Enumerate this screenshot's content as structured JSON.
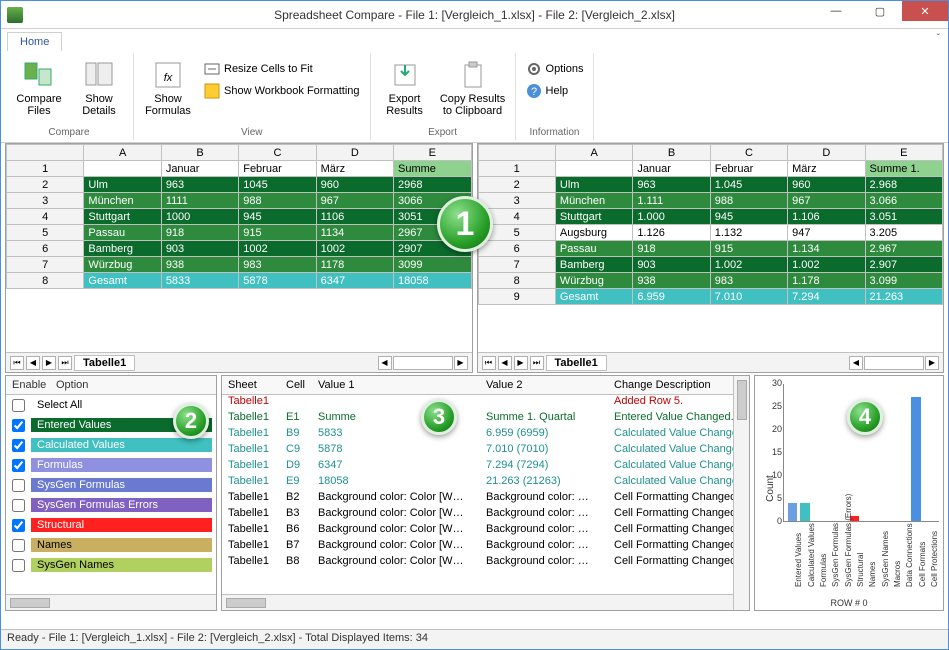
{
  "title": "Spreadsheet Compare - File 1: [Vergleich_1.xlsx] - File 2: [Vergleich_2.xlsx]",
  "tabs": {
    "home": "Home"
  },
  "ribbon": {
    "compare": {
      "label": "Compare",
      "compareFiles": "Compare\nFiles",
      "showDetails": "Show\nDetails"
    },
    "view": {
      "label": "View",
      "showFormulas": "Show\nFormulas",
      "resize": "Resize Cells to Fit",
      "formatting": "Show Workbook Formatting"
    },
    "export": {
      "label": "Export",
      "exportResults": "Export\nResults",
      "copyResults": "Copy Results\nto Clipboard"
    },
    "information": {
      "label": "Information",
      "options": "Options",
      "help": "Help"
    }
  },
  "sheetTab": "Tabelle1",
  "grid1": {
    "cols": [
      "A",
      "B",
      "C",
      "D",
      "E"
    ],
    "header": [
      "",
      "Januar",
      "Februar",
      "März",
      "Summe"
    ],
    "rows": [
      [
        "Ulm",
        "963",
        "1045",
        "960",
        "2968"
      ],
      [
        "München",
        "1111",
        "988",
        "967",
        "3066"
      ],
      [
        "Stuttgart",
        "1000",
        "945",
        "1106",
        "3051"
      ],
      [
        "Passau",
        "918",
        "915",
        "1134",
        "2967"
      ],
      [
        "Bamberg",
        "903",
        "1002",
        "1002",
        "2907"
      ],
      [
        "Würzbug",
        "938",
        "983",
        "1178",
        "3099"
      ],
      [
        "Gesamt",
        "5833",
        "5878",
        "6347",
        "18058"
      ]
    ]
  },
  "grid2": {
    "cols": [
      "A",
      "B",
      "C",
      "D",
      "E"
    ],
    "header": [
      "",
      "Januar",
      "Februar",
      "März",
      "Summe 1."
    ],
    "rows": [
      [
        "Ulm",
        "963",
        "1.045",
        "960",
        "2.968"
      ],
      [
        "München",
        "1.111",
        "988",
        "967",
        "3.066"
      ],
      [
        "Stuttgart",
        "1.000",
        "945",
        "1.106",
        "3.051"
      ],
      [
        "Augsburg",
        "1.126",
        "1.132",
        "947",
        "3.205"
      ],
      [
        "Passau",
        "918",
        "915",
        "1.134",
        "2.967"
      ],
      [
        "Bamberg",
        "903",
        "1.002",
        "1.002",
        "2.907"
      ],
      [
        "Würzbug",
        "938",
        "983",
        "1.178",
        "3.099"
      ],
      [
        "Gesamt",
        "6.959",
        "7.010",
        "7.294",
        "21.263"
      ]
    ]
  },
  "options": {
    "headerEnable": "Enable",
    "headerOption": "Option",
    "items": [
      {
        "checked": false,
        "label": "Select All",
        "cls": ""
      },
      {
        "checked": true,
        "label": "Entered Values",
        "cls": "ev"
      },
      {
        "checked": true,
        "label": "Calculated Values",
        "cls": "cv"
      },
      {
        "checked": true,
        "label": "Formulas",
        "cls": "fm"
      },
      {
        "checked": false,
        "label": "SysGen Formulas",
        "cls": "sf"
      },
      {
        "checked": false,
        "label": "SysGen Formulas Errors",
        "cls": "se"
      },
      {
        "checked": true,
        "label": "Structural",
        "cls": "st"
      },
      {
        "checked": false,
        "label": "Names",
        "cls": "nm"
      },
      {
        "checked": false,
        "label": "SysGen Names",
        "cls": "sn"
      }
    ]
  },
  "diff": {
    "headers": {
      "sheet": "Sheet",
      "cell": "Cell",
      "v1": "Value 1",
      "v2": "Value 2",
      "desc": "Change Description"
    },
    "rows": [
      {
        "sheet": "Tabelle1",
        "cell": "",
        "v1": "",
        "v2": "",
        "desc": "Added Row 5.",
        "color": "red"
      },
      {
        "sheet": "Tabelle1",
        "cell": "E1",
        "v1": "Summe",
        "v2": "Summe 1. Quartal",
        "desc": "Entered Value Changed.",
        "color": "green"
      },
      {
        "sheet": "Tabelle1",
        "cell": "B9",
        "v1": "5833",
        "v2": "6.959   (6959)",
        "desc": "Calculated Value Changed.",
        "color": "teal"
      },
      {
        "sheet": "Tabelle1",
        "cell": "C9",
        "v1": "5878",
        "v2": "7.010   (7010)",
        "desc": "Calculated Value Changed.",
        "color": "teal"
      },
      {
        "sheet": "Tabelle1",
        "cell": "D9",
        "v1": "6347",
        "v2": "7.294   (7294)",
        "desc": "Calculated Value Changed.",
        "color": "teal"
      },
      {
        "sheet": "Tabelle1",
        "cell": "E9",
        "v1": "18058",
        "v2": "21.263   (21263)",
        "desc": "Calculated Value Changed.",
        "color": "teal"
      },
      {
        "sheet": "Tabelle1",
        "cell": "B2",
        "v1": "Background color: Color [W…",
        "v2": "Background color: …",
        "desc": "Cell Formatting Changed",
        "color": "black"
      },
      {
        "sheet": "Tabelle1",
        "cell": "B3",
        "v1": "Background color: Color [W…",
        "v2": "Background color: …",
        "desc": "Cell Formatting Changed",
        "color": "black"
      },
      {
        "sheet": "Tabelle1",
        "cell": "B6",
        "v1": "Background color: Color [W…",
        "v2": "Background color: …",
        "desc": "Cell Formatting Changed",
        "color": "black"
      },
      {
        "sheet": "Tabelle1",
        "cell": "B7",
        "v1": "Background color: Color [W…",
        "v2": "Background color: …",
        "desc": "Cell Formatting Changed",
        "color": "black"
      },
      {
        "sheet": "Tabelle1",
        "cell": "B8",
        "v1": "Background color: Color [W…",
        "v2": "Background color: …",
        "desc": "Cell Formatting Changed",
        "color": "black"
      }
    ]
  },
  "status": "Ready - File 1: [Vergleich_1.xlsx] - File 2: [Vergleich_2.xlsx] - Total Displayed Items: 34",
  "badges": {
    "b1": "1",
    "b2": "2",
    "b3": "3",
    "b4": "4"
  },
  "chart_data": {
    "type": "bar",
    "ylabel": "Count",
    "xlabel": "ROW # 0",
    "ylim": [
      0,
      30
    ],
    "yticks": [
      0,
      5,
      10,
      15,
      20,
      25,
      30
    ],
    "categories": [
      "Entered Values",
      "Calculated Values",
      "Formulas",
      "SysGen Formulas",
      "SysGen Formulas (Errors)",
      "Structural",
      "Names",
      "SysGen Names",
      "Macros",
      "Data Connections",
      "Cell Formats",
      "Cell Protections"
    ],
    "values": [
      4,
      4,
      0,
      0,
      0,
      1,
      0,
      0,
      0,
      0,
      27,
      0
    ],
    "colors": [
      "#6aa0e0",
      "#40c0c0",
      "#9090e0",
      "#6a7ad0",
      "#8060c0",
      "#ff2020",
      "#c8b060",
      "#b0d060",
      "#999",
      "#999",
      "#4a90e2",
      "#999"
    ]
  }
}
